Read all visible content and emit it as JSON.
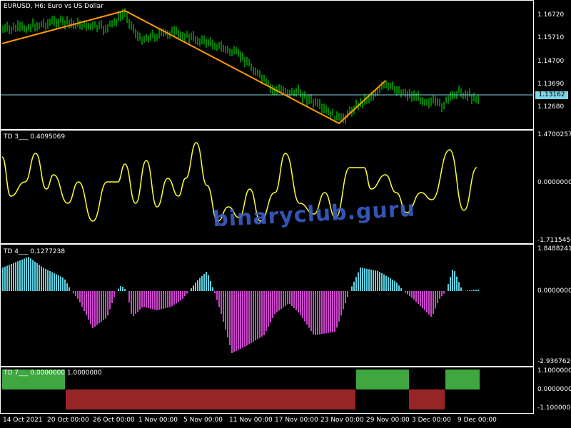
{
  "main": {
    "title": "EURUSD, H6:  Euro vs US Dollar",
    "current_price": "1.13162",
    "price_ticks": [
      "1.16720",
      "1.15710",
      "1.14700",
      "1.13690",
      "1.12680"
    ],
    "colors": {
      "up": "#00ff00",
      "zigzag": "#ff9900",
      "price_line": "#7fd6e6"
    }
  },
  "td3": {
    "label": "TD 3___  0.4095069",
    "ticks": [
      "1.4700257",
      "0.0000000",
      "-1.7115456"
    ],
    "color": "#ffff33"
  },
  "td4": {
    "label": "TD 4___  0.1277238",
    "ticks": [
      "1.8488241",
      "0.0000000",
      "-2.9367624"
    ],
    "colors": {
      "positive": "#5bd0e0",
      "negative": "#cc44cc"
    }
  },
  "td7": {
    "label": "TD 7___  0.0000000  1.0000000",
    "ticks": [
      "1.1000000",
      "0.0000000",
      "-1.1000000"
    ],
    "colors": {
      "up": "#55dd55",
      "down": "#cc3333"
    }
  },
  "dates": [
    "14 Oct 2021",
    "20 Oct 00:00",
    "26 Oct 00:00",
    "1 Nov 00:00",
    "5 Nov 00:00",
    "11 Nov 00:00",
    "17 Nov 00:00",
    "23 Nov 00:00",
    "29 Nov 00:00",
    "3 Dec 00:00",
    "9 Dec 00:00"
  ],
  "watermark": "binaryclub.guru"
}
